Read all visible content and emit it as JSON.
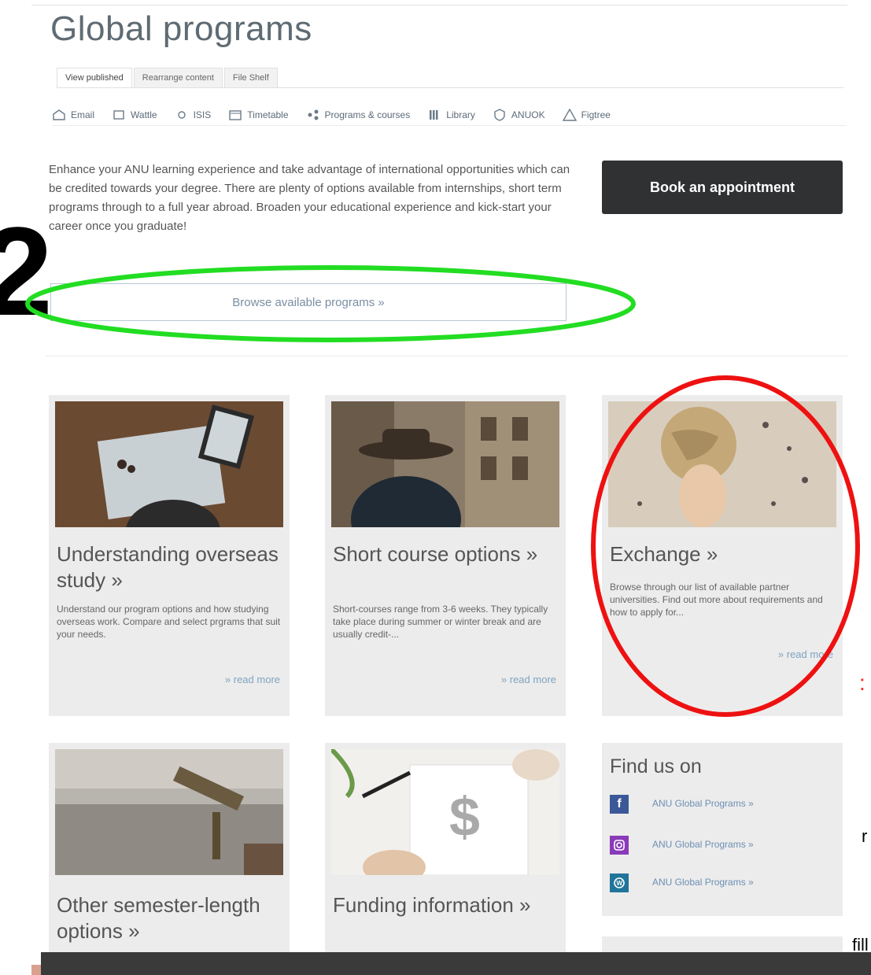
{
  "page": {
    "title": "Global programs"
  },
  "tabs": [
    {
      "label": "View published"
    },
    {
      "label": "Rearrange content"
    },
    {
      "label": "File Shelf"
    }
  ],
  "quicklinks": [
    {
      "label": "Email",
      "icon": "email-icon"
    },
    {
      "label": "Wattle",
      "icon": "wattle-icon"
    },
    {
      "label": "ISIS",
      "icon": "isis-icon"
    },
    {
      "label": "Timetable",
      "icon": "timetable-icon"
    },
    {
      "label": "Programs & courses",
      "icon": "programs-icon"
    },
    {
      "label": "Library",
      "icon": "library-icon"
    },
    {
      "label": "ANUOK",
      "icon": "anuok-icon"
    },
    {
      "label": "Figtree",
      "icon": "figtree-icon"
    }
  ],
  "intro": {
    "text": "Enhance your ANU learning experience and take advantage of international opportunities which can be credited towards your degree. There are plenty of options available from internships, short term programs through to a full year abroad. Broaden your educational experience and kick-start your career once you graduate!"
  },
  "book_button": {
    "label": "Book an appointment"
  },
  "browse_button": {
    "label": "Browse available programs »"
  },
  "annotation": {
    "step_number": "2",
    "side_red": ":",
    "side_r": "r",
    "side_fill": "fill"
  },
  "cards": [
    {
      "title": "Understanding overseas study »",
      "desc": "Understand our program options and how studying overseas work. Compare and select prgrams that suit your needs.",
      "more": "» read more"
    },
    {
      "title": "Short course options »",
      "desc": "Short-courses range from 3-6 weeks. They typically take place during summer or winter break and are usually credit-...",
      "more": "» read more"
    },
    {
      "title": "Exchange »",
      "desc": "Browse through our list of available partner universities. Find out more about requirements and how to apply for...",
      "more": "» read more"
    },
    {
      "title": "Other semester-length options »"
    },
    {
      "title": "Funding information »"
    }
  ],
  "find_us": {
    "title": "Find us on",
    "links": [
      {
        "label": "ANU Global Programs »",
        "icon": "facebook-icon",
        "color": "#3b5998"
      },
      {
        "label": "ANU Global Programs »",
        "icon": "instagram-icon",
        "color": "#8a3ab9"
      },
      {
        "label": "ANU Global Programs »",
        "icon": "wordpress-icon",
        "color": "#21759b"
      }
    ]
  },
  "colors": {
    "green_annotation": "#22dd22",
    "red_annotation": "#ee1111"
  }
}
